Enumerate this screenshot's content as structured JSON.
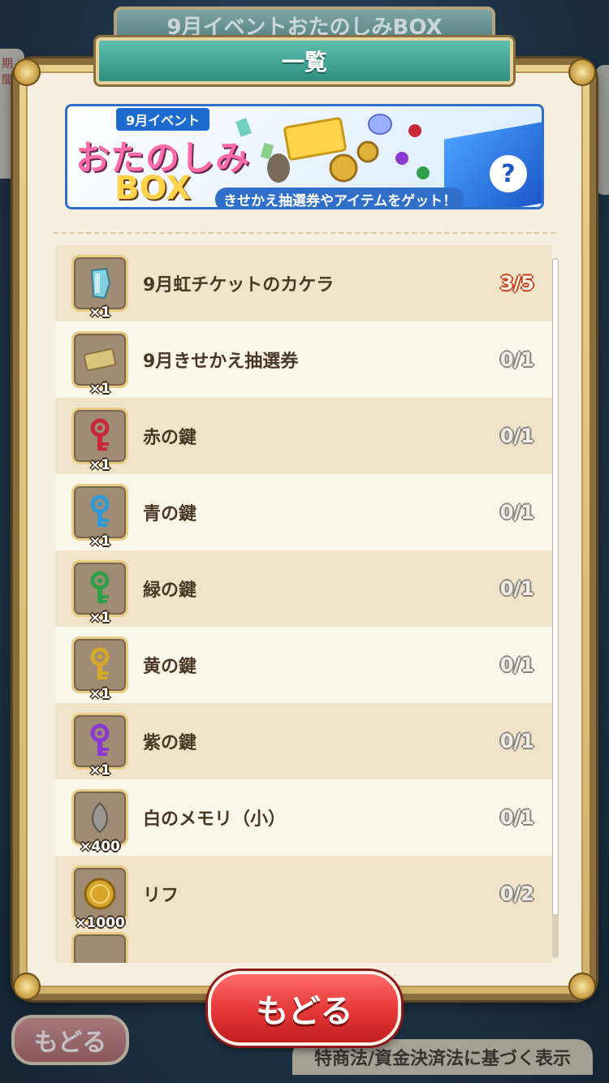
{
  "background": {
    "title": "9月イベントおたのしみBOX",
    "left_tag": "期間",
    "back_label": "もどる",
    "legal_label": "特商法/資金決済法に基づく表示"
  },
  "modal": {
    "title": "一覧",
    "banner": {
      "event_tag": "9月イベント",
      "title": "おたのしみ",
      "box": "BOX",
      "subtitle": "きせかえ抽選券やアイテムをゲット！"
    }
  },
  "items": [
    {
      "name": "9月虹チケットのカケラ",
      "qty": "×1",
      "count": "3/5",
      "icon": "rainbow-ticket-fragment-icon",
      "color": "#7fd0e0"
    },
    {
      "name": "9月きせかえ抽選券",
      "qty": "×1",
      "count": "0/1",
      "icon": "lottery-ticket-icon",
      "color": "#d9c27a"
    },
    {
      "name": "赤の鍵",
      "qty": "×1",
      "count": "0/1",
      "icon": "red-key-icon",
      "color": "#c8283a"
    },
    {
      "name": "青の鍵",
      "qty": "×1",
      "count": "0/1",
      "icon": "blue-key-icon",
      "color": "#2f9ad6"
    },
    {
      "name": "緑の鍵",
      "qty": "×1",
      "count": "0/1",
      "icon": "green-key-icon",
      "color": "#2ea04a"
    },
    {
      "name": "黄の鍵",
      "qty": "×1",
      "count": "0/1",
      "icon": "yellow-key-icon",
      "color": "#d6a82a"
    },
    {
      "name": "紫の鍵",
      "qty": "×1",
      "count": "0/1",
      "icon": "purple-key-icon",
      "color": "#8a3ad0"
    },
    {
      "name": "白のメモリ（小）",
      "qty": "×400",
      "count": "0/1",
      "icon": "white-memory-icon",
      "color": "#9a9690"
    },
    {
      "name": "リフ",
      "qty": "×1000",
      "count": "0/2",
      "icon": "rif-coin-icon",
      "color": "#d6a52a"
    }
  ],
  "back_button": "もどる",
  "colors": {
    "count_partial": "#c04520",
    "ribbon": "#3fa595",
    "back_button": "#e63a3a"
  }
}
